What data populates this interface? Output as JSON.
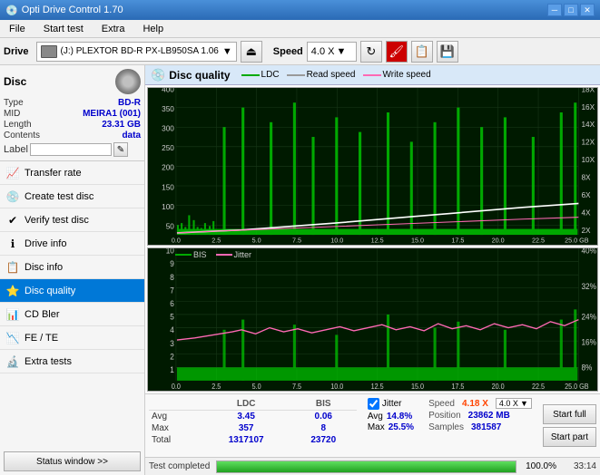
{
  "app": {
    "title": "Opti Drive Control 1.70",
    "icon": "💿"
  },
  "titlebar": {
    "title": "Opti Drive Control 1.70",
    "minimize": "─",
    "maximize": "□",
    "close": "✕"
  },
  "menubar": {
    "items": [
      "File",
      "Start test",
      "Extra",
      "Help"
    ]
  },
  "toolbar": {
    "drive_label": "Drive",
    "drive_value": "(J:)  PLEXTOR BD-R  PX-LB950SA 1.06",
    "speed_label": "Speed",
    "speed_value": "4.0 X"
  },
  "disc": {
    "title": "Disc",
    "type_label": "Type",
    "type_value": "BD-R",
    "mid_label": "MID",
    "mid_value": "MEIRA1 (001)",
    "length_label": "Length",
    "length_value": "23.31 GB",
    "contents_label": "Contents",
    "contents_value": "data",
    "label_label": "Label"
  },
  "nav": {
    "items": [
      {
        "id": "transfer-rate",
        "label": "Transfer rate",
        "icon": "📈"
      },
      {
        "id": "create-test-disc",
        "label": "Create test disc",
        "icon": "💿"
      },
      {
        "id": "verify-test-disc",
        "label": "Verify test disc",
        "icon": "✔"
      },
      {
        "id": "drive-info",
        "label": "Drive info",
        "icon": "ℹ"
      },
      {
        "id": "disc-info",
        "label": "Disc info",
        "icon": "📋"
      },
      {
        "id": "disc-quality",
        "label": "Disc quality",
        "icon": "⭐",
        "active": true
      },
      {
        "id": "cd-bler",
        "label": "CD Bler",
        "icon": "📊"
      },
      {
        "id": "fe-te",
        "label": "FE / TE",
        "icon": "📉"
      },
      {
        "id": "extra-tests",
        "label": "Extra tests",
        "icon": "🔬"
      }
    ],
    "status_btn": "Status window >>"
  },
  "quality": {
    "title": "Disc quality",
    "legend": [
      {
        "label": "LDC",
        "color": "#00aa00"
      },
      {
        "label": "Read speed",
        "color": "#ffffff"
      },
      {
        "label": "Write speed",
        "color": "#ff69b4"
      }
    ],
    "legend2": [
      {
        "label": "BIS",
        "color": "#00aa00"
      },
      {
        "label": "Jitter",
        "color": "#ff69b4"
      }
    ],
    "chart1": {
      "y_left": [
        "400",
        "350",
        "300",
        "250",
        "200",
        "150",
        "100",
        "50"
      ],
      "y_right": [
        "18X",
        "16X",
        "14X",
        "12X",
        "10X",
        "8X",
        "6X",
        "4X",
        "2X"
      ],
      "x": [
        "0.0",
        "2.5",
        "5.0",
        "7.5",
        "10.0",
        "12.5",
        "15.0",
        "17.5",
        "20.0",
        "22.5",
        "25.0 GB"
      ]
    },
    "chart2": {
      "y_left": [
        "10",
        "9",
        "8",
        "7",
        "6",
        "5",
        "4",
        "3",
        "2",
        "1"
      ],
      "y_right": [
        "40%",
        "32%",
        "24%",
        "16%",
        "8%"
      ],
      "x": [
        "0.0",
        "2.5",
        "5.0",
        "7.5",
        "10.0",
        "12.5",
        "15.0",
        "17.5",
        "20.0",
        "22.5",
        "25.0 GB"
      ]
    }
  },
  "stats": {
    "columns": [
      "LDC",
      "BIS"
    ],
    "avg_label": "Avg",
    "avg_ldc": "3.45",
    "avg_bis": "0.06",
    "max_label": "Max",
    "max_ldc": "357",
    "max_bis": "8",
    "total_label": "Total",
    "total_ldc": "1317107",
    "total_bis": "23720",
    "jitter_label": "Jitter",
    "jitter_avg": "14.8%",
    "jitter_max": "25.5%",
    "speed_label": "Speed",
    "speed_value": "4.18 X",
    "speed_select": "4.0 X",
    "position_label": "Position",
    "position_value": "23862 MB",
    "samples_label": "Samples",
    "samples_value": "381587",
    "btn_full": "Start full",
    "btn_part": "Start part"
  },
  "statusbar": {
    "status_text": "Test completed",
    "progress_pct": "100.0%",
    "progress_time": "33:14"
  }
}
